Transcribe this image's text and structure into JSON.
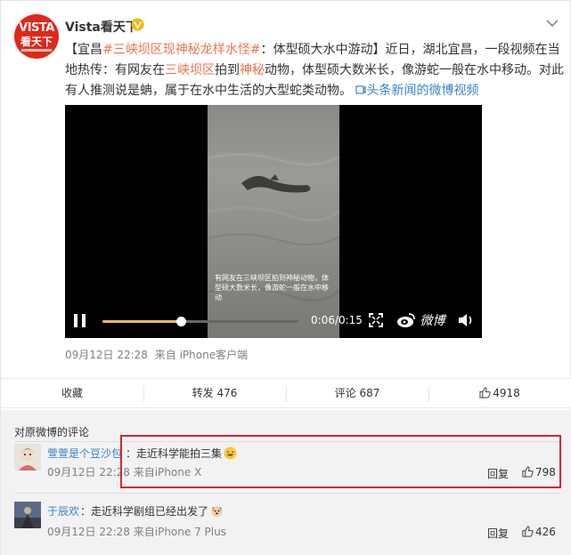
{
  "post": {
    "avatar": {
      "line1": "VISTA",
      "line2": "看天下"
    },
    "username": "Vista看天下",
    "verified_badge": "v-badge-icon",
    "text": {
      "p1": "【宜昌",
      "t1": "#三峡坝区现神秘龙样水怪#",
      "p2": "：体型硕大水中游动】近日，湖北宜昌，一段视频在当地热传：有网友在",
      "t2": "三峡坝区",
      "p3": "拍到",
      "t3": "神秘",
      "p4": "动物，体型硕大数米长，像游蛇一般在水中移动。对此有人推测说是蚺，属于在水中生活的大型蛇类动物。",
      "link": "头条新闻的微博视频"
    },
    "video": {
      "overlay_text": "有网友在三峡坝区拍到神秘动物，体型硕大数米长，像游蛇一般在水中移动",
      "time": "0:06/0:15",
      "progress": 0.4,
      "brand": "微博"
    },
    "meta": {
      "date": "09月12日 22:28",
      "source": "来自 iPhone客户端"
    }
  },
  "actions": {
    "favorite": "收藏",
    "repost": "转发 476",
    "comment": "评论 687",
    "like_count": "4918"
  },
  "comments_section": {
    "title": "对原微博的评论",
    "items": [
      {
        "name": "萱萱是个豆沙包",
        "text": "：走近科学能拍三集",
        "emoji": "laughing-emoji",
        "meta": "09月12日 22:28 来自iPhone X",
        "reply": "回复",
        "likes": "798"
      },
      {
        "name": "于辰欢",
        "text": "：走近科学剧组已经出发了",
        "emoji": "dog-emoji",
        "meta": "09月12日 22:28 来自iPhone 7 Plus",
        "reply": "回复",
        "likes": "426"
      }
    ]
  },
  "colors": {
    "topic": "#eb7350",
    "link": "#3a84c6",
    "highlight_box": "#d9252c",
    "progress": "#f1b65c"
  }
}
